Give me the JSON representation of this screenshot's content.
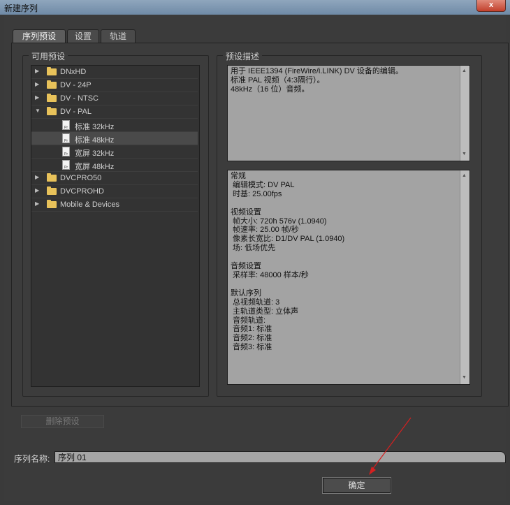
{
  "window": {
    "title": "新建序列",
    "close_label": "x"
  },
  "tabs": [
    {
      "label": "序列预设",
      "active": true
    },
    {
      "label": "设置",
      "active": false
    },
    {
      "label": "轨道",
      "active": false
    }
  ],
  "presets": {
    "group_label": "可用预设",
    "items": [
      {
        "label": "DNxHD",
        "type": "folder",
        "expanded": false,
        "selected": false
      },
      {
        "label": "DV - 24P",
        "type": "folder",
        "expanded": false,
        "selected": false
      },
      {
        "label": "DV - NTSC",
        "type": "folder",
        "expanded": false,
        "selected": false
      },
      {
        "label": "DV - PAL",
        "type": "folder",
        "expanded": true,
        "selected": false
      },
      {
        "label": "标准 32kHz",
        "type": "preset",
        "selected": false
      },
      {
        "label": "标准 48kHz",
        "type": "preset",
        "selected": true
      },
      {
        "label": "宽屏 32kHz",
        "type": "preset",
        "selected": false
      },
      {
        "label": "宽屏 48kHz",
        "type": "preset",
        "selected": false
      },
      {
        "label": "DVCPRO50",
        "type": "folder",
        "expanded": false,
        "selected": false
      },
      {
        "label": "DVCPROHD",
        "type": "folder",
        "expanded": false,
        "selected": false
      },
      {
        "label": "Mobile & Devices",
        "type": "folder",
        "expanded": false,
        "selected": false
      }
    ],
    "doc_icon_text": "Pr"
  },
  "description": {
    "group_label": "预设描述",
    "summary": "用于 IEEE1394 (FireWire/i.LINK) DV 设备的编辑。\n标准 PAL 视频（4:3隔行）。\n48kHz（16 位）音频。",
    "details": "常规\n 编辑模式: DV PAL\n 时基: 25.00fps\n\n视频设置\n 帧大小: 720h 576v (1.0940)\n 帧速率: 25.00 帧/秒\n 像素长宽比: D1/DV PAL (1.0940)\n 场: 低场优先\n\n音频设置\n 采样率: 48000 样本/秒\n\n默认序列\n 总视频轨道: 3\n 主轨道类型: 立体声\n 音频轨道:\n 音频1: 标准\n 音频2: 标准\n 音频3: 标准"
  },
  "buttons": {
    "delete_preset": "删除预设",
    "ok": "确定"
  },
  "sequence_name": {
    "label": "序列名称:",
    "value": "序列 01"
  },
  "colors": {
    "annotation_arrow": "#d42020",
    "folder": "#e8c25a"
  }
}
